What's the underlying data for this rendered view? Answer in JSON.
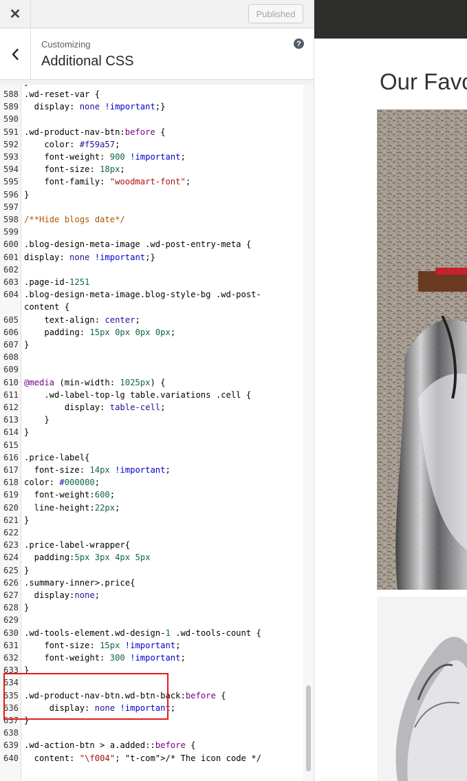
{
  "topbar": {
    "close_label": "✕",
    "publish_label": "Published"
  },
  "header": {
    "breadcrumb": "Customizing",
    "title": "Additional CSS",
    "help_label": "?"
  },
  "colors": {
    "highlight": "#e01b1b",
    "preview_bar": "#2e2e2b",
    "code_keyword": "#0000cc",
    "code_string": "#aa1111",
    "code_number": "#116644",
    "code_comment": "#aa5500"
  },
  "icons": {
    "close": "close-icon",
    "back": "chevron-left-icon",
    "help": "help-icon"
  },
  "preview": {
    "heading": "Our Favo"
  },
  "code_lines": [
    {
      "n": "588",
      "t": ".wd-reset-var {"
    },
    {
      "n": "589",
      "t": "  display: none !important;}"
    },
    {
      "n": "590",
      "t": ""
    },
    {
      "n": "591",
      "t": ".wd-product-nav-btn:before {"
    },
    {
      "n": "592",
      "t": "    color: #f59a57;"
    },
    {
      "n": "593",
      "t": "    font-weight: 900 !important;"
    },
    {
      "n": "594",
      "t": "    font-size: 18px;"
    },
    {
      "n": "595",
      "t": "    font-family: \"woodmart-font\";"
    },
    {
      "n": "596",
      "t": "}"
    },
    {
      "n": "597",
      "t": ""
    },
    {
      "n": "598",
      "t": "/**Hide blogs date*/"
    },
    {
      "n": "599",
      "t": ""
    },
    {
      "n": "600",
      "t": ".blog-design-meta-image .wd-post-entry-meta {"
    },
    {
      "n": "601",
      "t": "display: none !important;}"
    },
    {
      "n": "602",
      "t": ""
    },
    {
      "n": "603",
      "t": ".page-id-1251"
    },
    {
      "n": "604",
      "t": ".blog-design-meta-image.blog-style-bg .wd-post-"
    },
    {
      "n": "",
      "t": "content {"
    },
    {
      "n": "605",
      "t": "    text-align: center;"
    },
    {
      "n": "606",
      "t": "    padding: 15px 0px 0px 0px;"
    },
    {
      "n": "607",
      "t": "}"
    },
    {
      "n": "608",
      "t": ""
    },
    {
      "n": "609",
      "t": ""
    },
    {
      "n": "610",
      "t": "@media (min-width: 1025px) {"
    },
    {
      "n": "611",
      "t": "    .wd-label-top-lg table.variations .cell {"
    },
    {
      "n": "612",
      "t": "        display: table-cell;"
    },
    {
      "n": "613",
      "t": "    }"
    },
    {
      "n": "614",
      "t": "}"
    },
    {
      "n": "615",
      "t": ""
    },
    {
      "n": "616",
      "t": ".price-label{"
    },
    {
      "n": "617",
      "t": "  font-size: 14px !important;"
    },
    {
      "n": "618",
      "t": "color: #000000;"
    },
    {
      "n": "619",
      "t": "  font-weight:600;"
    },
    {
      "n": "620",
      "t": "  line-height:22px;"
    },
    {
      "n": "621",
      "t": "}"
    },
    {
      "n": "622",
      "t": ""
    },
    {
      "n": "623",
      "t": ".price-label-wrapper{"
    },
    {
      "n": "624",
      "t": "  padding:5px 3px 4px 5px"
    },
    {
      "n": "625",
      "t": "}"
    },
    {
      "n": "626",
      "t": ".summary-inner>.price{"
    },
    {
      "n": "627",
      "t": "  display:none;"
    },
    {
      "n": "628",
      "t": "}"
    },
    {
      "n": "629",
      "t": ""
    },
    {
      "n": "630",
      "t": ".wd-tools-element.wd-design-1 .wd-tools-count {"
    },
    {
      "n": "631",
      "t": "    font-size: 15px !important;"
    },
    {
      "n": "632",
      "t": "    font-weight: 300 !important;"
    },
    {
      "n": "633",
      "t": "}"
    },
    {
      "n": "634",
      "t": ""
    },
    {
      "n": "635",
      "t": ".wd-product-nav-btn.wd-btn-back:before {"
    },
    {
      "n": "636",
      "t": "     display: none !important;"
    },
    {
      "n": "637",
      "t": "}"
    },
    {
      "n": "638",
      "t": ""
    },
    {
      "n": "639",
      "t": ".wd-action-btn > a.added::before {"
    },
    {
      "n": "640",
      "t": "  content: \"\\f004\"; /* The icon code */"
    }
  ]
}
